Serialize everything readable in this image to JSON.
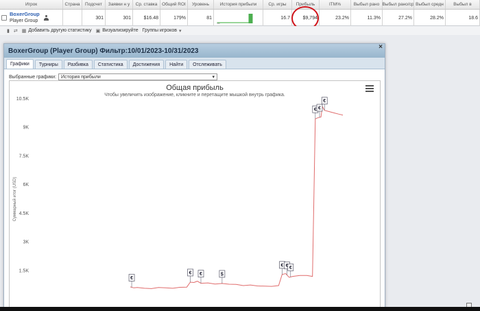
{
  "stats": {
    "headers": [
      "Игрок",
      "Страна",
      "Подсчет",
      "Заявки н у",
      "Ср. ставка",
      "Общий ROI",
      "Уровень",
      "История прибыли",
      "Ср. игры",
      "Прибыль",
      "ITM%",
      "Выбыл рано",
      "Выбыл рано/ср",
      "Выбыл средн",
      "Выбыл в"
    ],
    "row": {
      "player_name": "BoxerGroup",
      "player_group": "Player Group",
      "country": "",
      "count": "301",
      "entries": "301",
      "avg_stake": "$16.48",
      "roi": "179%",
      "level": "81",
      "avg_games": "16.7",
      "profit": "$9,794",
      "itm": "23.2%",
      "early": "11.3%",
      "early_mid": "27.2%",
      "mid": "28.2%",
      "late": "18.6"
    }
  },
  "toolbar": {
    "add_label": "Добавить другую статистику",
    "visualize_label": "Визуализируйте",
    "groups_label": "Группы игроков"
  },
  "modal": {
    "title": "BoxerGroup (Player Group) Фильтр:10/01/2023-10/31/2023",
    "close_label": "×",
    "tabs": [
      "Графики",
      "Турниры",
      "Разбивка",
      "Статистика",
      "Достижения",
      "Найти",
      "Отслеживать"
    ],
    "selector_label": "Выбранные графики:",
    "selector_value": "История прибыли"
  },
  "chart_data": {
    "type": "line",
    "title": "Общая прибыль",
    "subtitle": "Чтобы увеличить изображение, кликните и перетащите мышкой внутрь графика.",
    "ylabel": "Суммарный итог (USD)",
    "ytick_labels": [
      "1.5K",
      "3K",
      "4.5K",
      "6K",
      "7.5K",
      "9K",
      "10.5K"
    ],
    "ytick_values": [
      1500,
      3000,
      4500,
      6000,
      7500,
      9000,
      10500
    ],
    "ylim": [
      0,
      10500
    ],
    "color": "#e06c6c",
    "x": [
      0,
      5,
      10,
      20,
      30,
      40,
      50,
      60,
      70,
      80,
      85,
      90,
      95,
      100,
      110,
      120,
      130,
      140,
      150,
      160,
      170,
      180,
      190,
      200,
      210,
      215,
      220,
      225,
      230,
      240,
      250,
      258,
      262,
      265,
      270,
      272,
      275,
      280,
      285,
      290,
      295,
      301
    ],
    "y": [
      650,
      600,
      620,
      580,
      560,
      620,
      600,
      580,
      630,
      640,
      900,
      880,
      950,
      840,
      860,
      800,
      830,
      790,
      780,
      720,
      750,
      700,
      690,
      680,
      720,
      1300,
      1350,
      1150,
      1200,
      1250,
      1250,
      1200,
      9450,
      9500,
      9550,
      10100,
      9900,
      9850,
      9800,
      9750,
      9700,
      9650
    ],
    "markers": [
      {
        "x": 2,
        "symbol": "€"
      },
      {
        "x": 85,
        "symbol": "€"
      },
      {
        "x": 100,
        "symbol": "€"
      },
      {
        "x": 130,
        "symbol": "$"
      },
      {
        "x": 215,
        "symbol": "€"
      },
      {
        "x": 222,
        "symbol": "€"
      },
      {
        "x": 227,
        "symbol": "€"
      },
      {
        "x": 262,
        "symbol": "€"
      },
      {
        "x": 268,
        "symbol": "€"
      },
      {
        "x": 275,
        "symbol": "€"
      }
    ]
  }
}
